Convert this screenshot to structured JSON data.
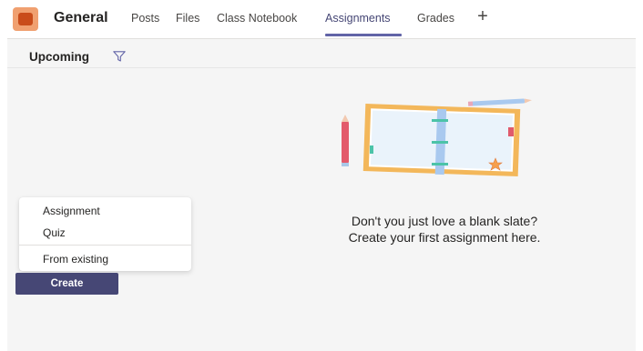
{
  "header": {
    "channel_name": "General",
    "tabs": [
      {
        "label": "Posts"
      },
      {
        "label": "Files"
      },
      {
        "label": "Class Notebook"
      },
      {
        "label": "Assignments",
        "active": true
      },
      {
        "label": "Grades"
      }
    ],
    "add_tab_glyph": "+"
  },
  "subheader": {
    "view_label": "Upcoming"
  },
  "empty_state": {
    "line1": "Don't you just love a blank slate?",
    "line2": "Create your first assignment here."
  },
  "create_menu": {
    "items": [
      {
        "label": "Assignment"
      },
      {
        "label": "Quiz"
      },
      {
        "label": "From existing"
      }
    ]
  },
  "create_button": {
    "label": "Create"
  },
  "colors": {
    "accent": "#6264a7",
    "button": "#464775",
    "team_icon": "#c94c1a"
  }
}
